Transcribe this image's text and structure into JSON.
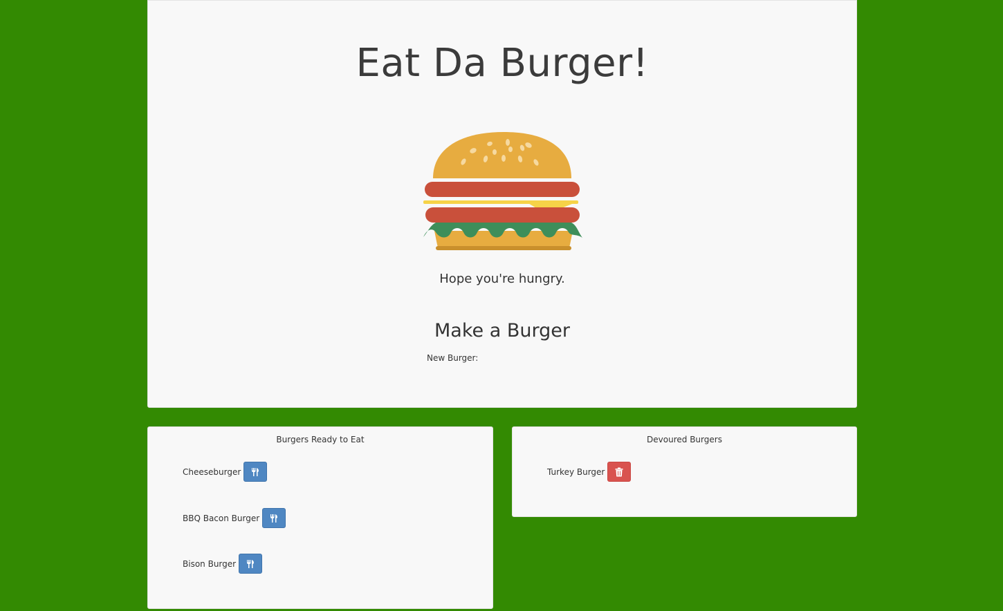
{
  "header": {
    "title": "Eat Da Burger!",
    "tagline": "Hope you're hungry."
  },
  "form": {
    "heading": "Make a Burger",
    "label": "New Burger:",
    "value": "",
    "placeholder": ""
  },
  "ready": {
    "title": "Burgers Ready to Eat",
    "action_icon": "utensils-icon",
    "items": [
      {
        "name": "Cheeseburger"
      },
      {
        "name": "BBQ Bacon Burger"
      },
      {
        "name": "Bison Burger"
      }
    ]
  },
  "devoured": {
    "title": "Devoured Burgers",
    "action_icon": "trash-icon",
    "items": [
      {
        "name": "Turkey Burger"
      }
    ]
  },
  "colors": {
    "background": "#338a02",
    "panel": "#f8f8f8",
    "devour_button": "#4f87c2",
    "delete_button": "#d9534f"
  }
}
